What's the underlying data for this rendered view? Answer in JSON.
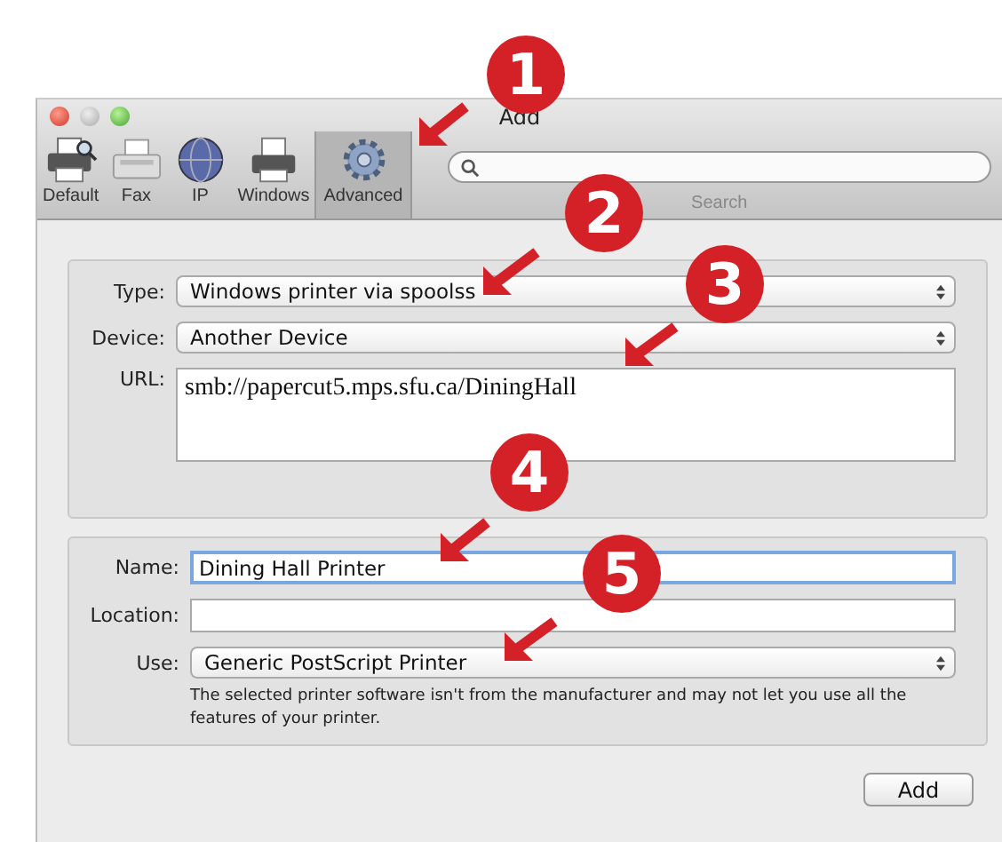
{
  "window": {
    "title": "Add"
  },
  "toolbar": {
    "items": [
      {
        "label": "Default",
        "kind": "printer-search",
        "selected": false
      },
      {
        "label": "Fax",
        "kind": "fax",
        "selected": false
      },
      {
        "label": "IP",
        "kind": "globe",
        "selected": false
      },
      {
        "label": "Windows",
        "kind": "printer",
        "selected": false
      },
      {
        "label": "Advanced",
        "kind": "gear",
        "selected": true
      }
    ],
    "search_label": "Search"
  },
  "connection": {
    "type_label": "Type:",
    "type_value": "Windows printer via spoolss",
    "device_label": "Device:",
    "device_value": "Another Device",
    "url_label": "URL:",
    "url_value": "smb://papercut5.mps.sfu.ca/DiningHall"
  },
  "details": {
    "name_label": "Name:",
    "name_value": "Dining Hall Printer",
    "location_label": "Location:",
    "use_label": "Use:",
    "use_value": "Generic PostScript Printer",
    "note": "The selected printer software isn't from the manufacturer and may not let you use all the features of your printer."
  },
  "buttons": [
    "Add"
  ],
  "callouts": [
    {
      "number": "1"
    },
    {
      "number": "2"
    },
    {
      "number": "3"
    },
    {
      "number": "4"
    },
    {
      "number": "5"
    }
  ]
}
